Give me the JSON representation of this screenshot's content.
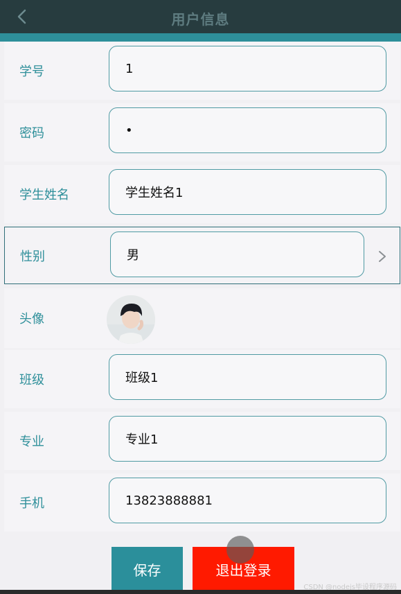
{
  "header": {
    "title": "用户信息"
  },
  "form": {
    "rows": [
      {
        "label": "学号",
        "value": "1"
      },
      {
        "label": "密码",
        "value": "•"
      },
      {
        "label": "学生姓名",
        "value": "学生姓名1"
      },
      {
        "label": "性别",
        "value": "男"
      },
      {
        "label": "头像"
      },
      {
        "label": "班级",
        "value": "班级1"
      },
      {
        "label": "专业",
        "value": "专业1"
      },
      {
        "label": "手机",
        "value": "13823888881"
      }
    ]
  },
  "actions": {
    "save_label": "保存",
    "logout_label": "退出登录"
  },
  "watermark": "CSDN @nodejs毕设程序源码"
}
